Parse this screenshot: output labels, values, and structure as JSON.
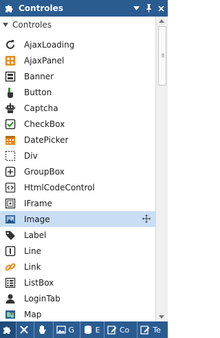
{
  "window": {
    "title": "Controles"
  },
  "group": {
    "title": "Controles"
  },
  "items": [
    {
      "label": "AjaxLoading",
      "icon": "refresh-icon"
    },
    {
      "label": "AjaxPanel",
      "icon": "ajax-panel-icon"
    },
    {
      "label": "Banner",
      "icon": "banner-icon"
    },
    {
      "label": "Button",
      "icon": "pointer-hand-icon"
    },
    {
      "label": "Captcha",
      "icon": "robot-icon"
    },
    {
      "label": "CheckBox",
      "icon": "checkbox-icon"
    },
    {
      "label": "DatePicker",
      "icon": "calendar-icon"
    },
    {
      "label": "Div",
      "icon": "dashed-square-icon"
    },
    {
      "label": "GroupBox",
      "icon": "groupbox-icon"
    },
    {
      "label": "HtmlCodeControl",
      "icon": "code-icon"
    },
    {
      "label": "IFrame",
      "icon": "iframe-icon"
    },
    {
      "label": "Image",
      "icon": "image-icon",
      "selected": true
    },
    {
      "label": "Label",
      "icon": "tag-icon"
    },
    {
      "label": "Line",
      "icon": "line-icon"
    },
    {
      "label": "Link",
      "icon": "chain-link-icon"
    },
    {
      "label": "ListBox",
      "icon": "listbox-icon"
    },
    {
      "label": "LoginTab",
      "icon": "user-icon"
    },
    {
      "label": "Map",
      "icon": "map-icon"
    }
  ],
  "tabs": [
    {
      "label": "",
      "icon": "puzzle-icon"
    },
    {
      "label": "",
      "icon": "tools-icon"
    },
    {
      "label": "",
      "icon": "hand-icon"
    },
    {
      "label": "G",
      "icon": "image-icon"
    },
    {
      "label": "E",
      "icon": "database-icon"
    },
    {
      "label": "Co",
      "icon": "edit-icon"
    },
    {
      "label": "Te",
      "icon": "edit-icon"
    }
  ],
  "colors": {
    "titlebar": "#2a5c91",
    "selection": "#c9def5"
  }
}
